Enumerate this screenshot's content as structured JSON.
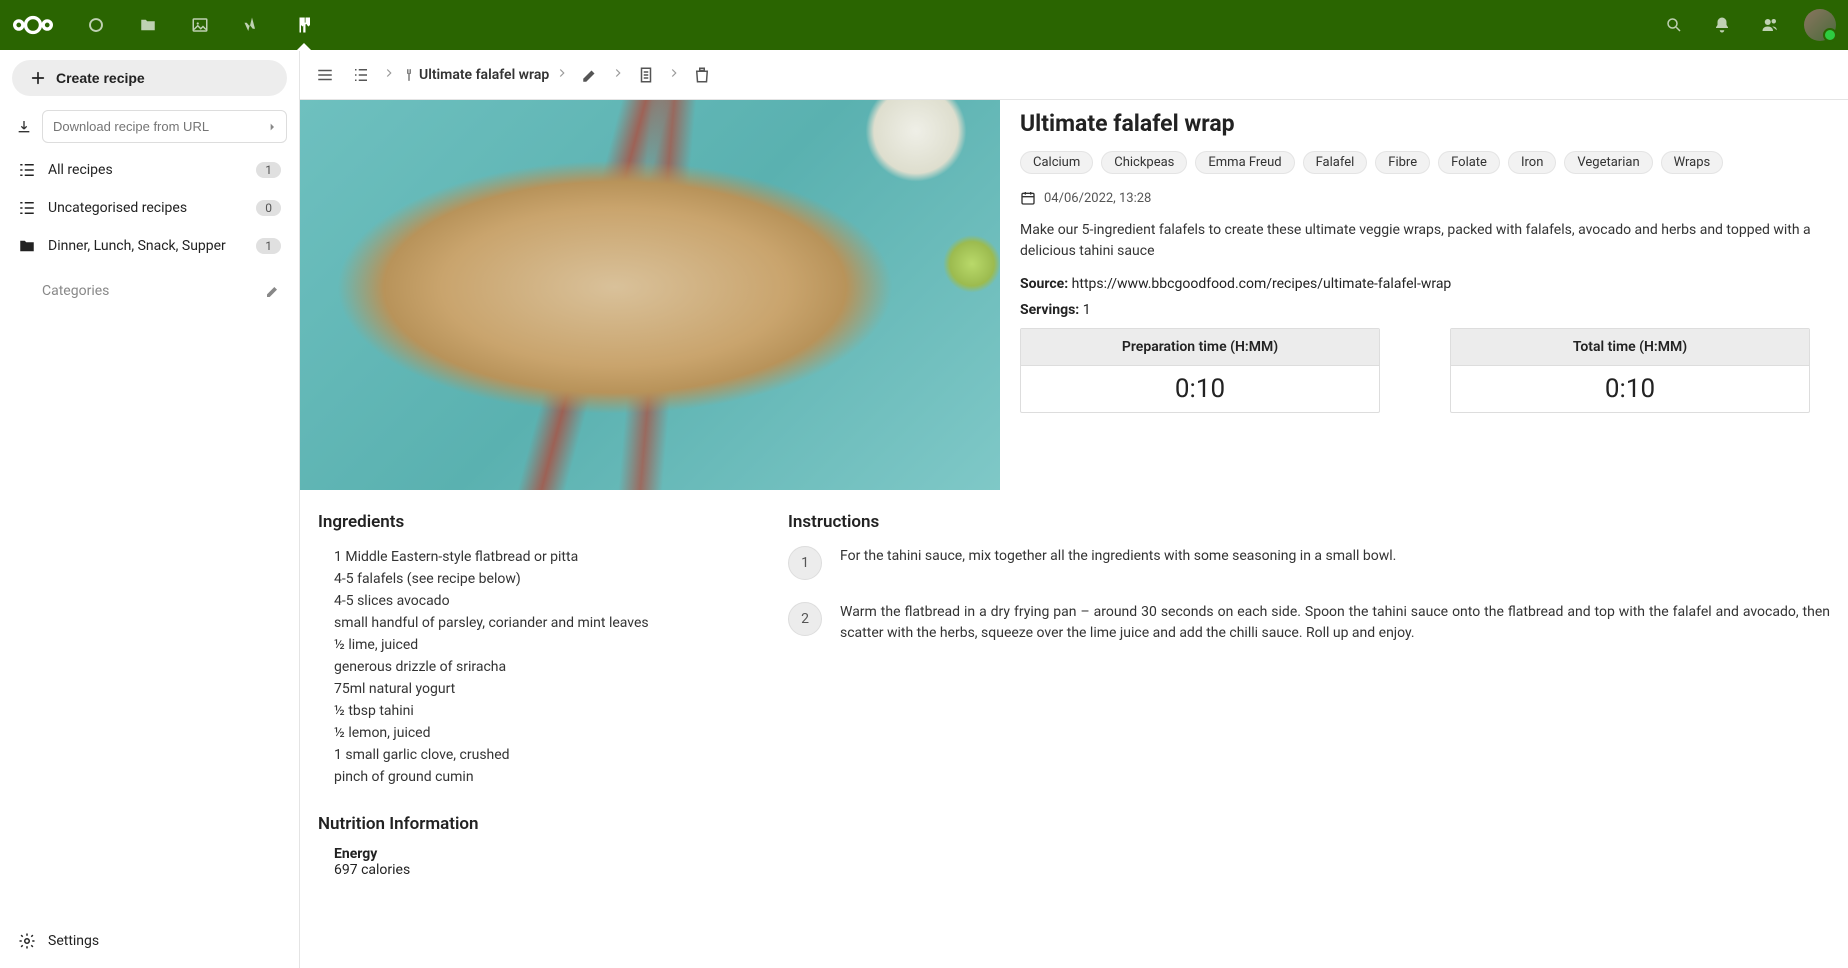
{
  "sidebar": {
    "create_label": "Create recipe",
    "url_placeholder": "Download recipe from URL",
    "items": [
      {
        "label": "All recipes",
        "badge": "1"
      },
      {
        "label": "Uncategorised recipes",
        "badge": "0"
      },
      {
        "label": "Dinner, Lunch, Snack, Supper",
        "badge": "1"
      }
    ],
    "categories_label": "Categories",
    "settings_label": "Settings"
  },
  "crumbs": {
    "title": "Ultimate falafel wrap"
  },
  "recipe": {
    "title": "Ultimate falafel wrap",
    "tags": [
      "Calcium",
      "Chickpeas",
      "Emma Freud",
      "Falafel",
      "Fibre",
      "Folate",
      "Iron",
      "Vegetarian",
      "Wraps"
    ],
    "date": "04/06/2022, 13:28",
    "description": "Make our 5-ingredient falafels to create these ultimate veggie wraps, packed with falafels, avocado and herbs and topped with a delicious tahini sauce",
    "source_label": "Source:",
    "source_url": "https://www.bbcgoodfood.com/recipes/ultimate-falafel-wrap",
    "servings_label": "Servings:",
    "servings": "1",
    "prep_label": "Preparation time (H:MM)",
    "prep_value": "0:10",
    "total_label": "Total time (H:MM)",
    "total_value": "0:10"
  },
  "ingredients": {
    "title": "Ingredients",
    "items": [
      "1 Middle Eastern-style flatbread or pitta",
      "4-5 falafels (see recipe below)",
      "4-5 slices avocado",
      "small handful of parsley, coriander and mint leaves",
      "½ lime, juiced",
      "generous drizzle of sriracha",
      "75ml natural yogurt",
      "½ tbsp tahini",
      "½ lemon, juiced",
      "1 small garlic clove, crushed",
      "pinch of ground cumin"
    ]
  },
  "instructions": {
    "title": "Instructions",
    "steps": [
      "For the tahini sauce, mix together all the ingredients with some seasoning in a small bowl.",
      "Warm the flatbread in a dry frying pan – around 30 seconds on each side. Spoon the tahini sauce onto the flatbread and top with the falafel and avocado, then scatter with the herbs, squeeze over the lime juice and add the chilli sauce. Roll up and enjoy."
    ]
  },
  "nutrition": {
    "title": "Nutrition Information",
    "energy_label": "Energy",
    "energy_value": "697 calories"
  }
}
